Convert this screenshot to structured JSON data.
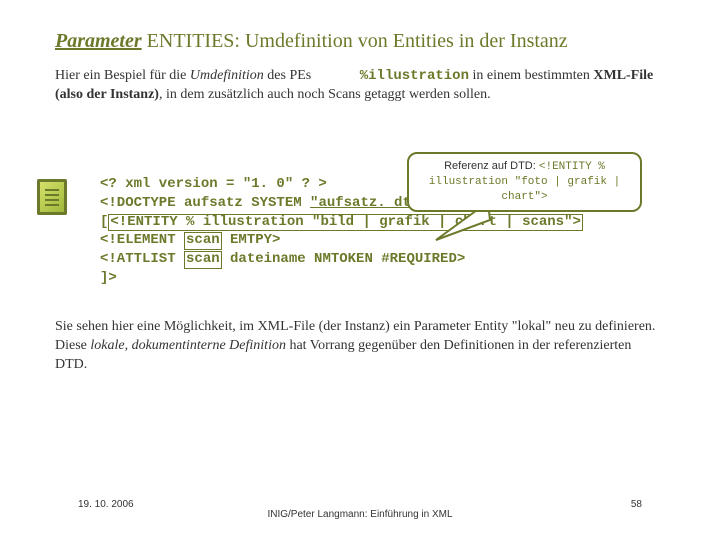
{
  "heading": {
    "lead": "Parameter",
    "rest": " ENTITIES: Umdefinition von Entities in der Instanz"
  },
  "intro": {
    "t1": "Hier ein Bespiel für die ",
    "t2": "Umdefinition",
    "t3": " des PEs ",
    "t4": "%illustration",
    "t5": " in einem bestimmten ",
    "t6": "XML-File (also der Instanz)",
    "t7": ", in dem zusätzlich auch noch Scans getaggt werden sollen."
  },
  "callout": {
    "label": "Referenz auf DTD: ",
    "code": "<!ENTITY % illustration \"foto | grafik | chart\">"
  },
  "code": {
    "l1": "<? xml version = \"1. 0\" ? >",
    "l2a": "<!DOCTYPE aufsatz SYSTEM ",
    "l2b": "\"aufsatz. dtd\"",
    "l3a": "[",
    "l3b": "<!ENTITY % illustration \"bild | grafik | chart | scans\">",
    "l4a": "<!ELEMENT ",
    "l4b": "scan",
    "l4c": " EMTPY>",
    "l5a": "<!ATTLIST ",
    "l5b": "scan",
    "l5c": " dateiname NMTOKEN #REQUIRED>",
    "l6": "]>"
  },
  "outro": {
    "t1": "Sie sehen hier eine Möglichkeit, im XML-File (der Instanz) ein Parameter Entity \"lokal\" neu zu definieren. Diese ",
    "t2": "lokale, dokumentinterne Definition",
    "t3": " hat Vorrang gegenüber den Definitionen in der referenzierten DTD."
  },
  "footer": {
    "date": "19. 10. 2006",
    "center": "INIG/Peter Langmann: Einführung in XML",
    "page": "58"
  }
}
